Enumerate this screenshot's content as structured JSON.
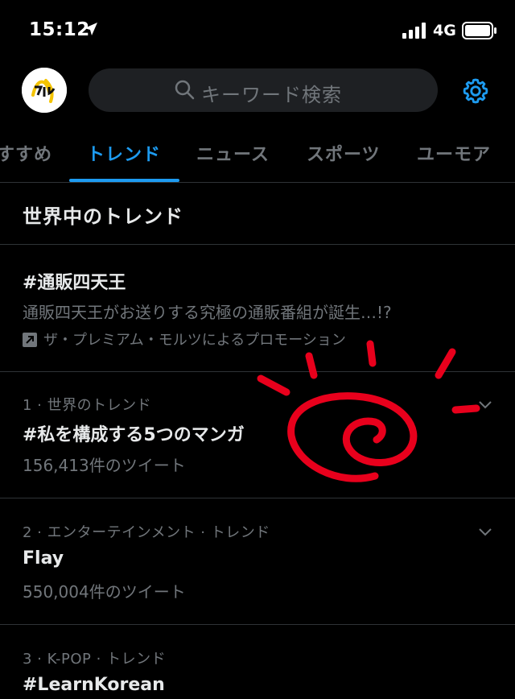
{
  "status_bar": {
    "time": "15:12",
    "network": "4G"
  },
  "header": {
    "search_placeholder": "キーワード検索"
  },
  "tabs": [
    {
      "label": "すすめ"
    },
    {
      "label": "トレンド",
      "active": true
    },
    {
      "label": "ニュース"
    },
    {
      "label": "スポーツ"
    },
    {
      "label": "ユーモア"
    }
  ],
  "section": {
    "title": "世界中のトレンド"
  },
  "promoted": {
    "title": "#通販四天王",
    "description": "通販四天王がお送りする究極の通販番組が誕生…!?",
    "promoted_by": "ザ・プレミアム・モルツによるプロモーション"
  },
  "trends": [
    {
      "meta": "1 · 世界のトレンド",
      "name": "#私を構成する5つのマンガ",
      "count": "156,413件のツイート"
    },
    {
      "meta": "2 · エンターテインメント · トレンド",
      "name": "Flay",
      "count": "550,004件のツイート"
    },
    {
      "meta": "3 · K-POP · トレンド",
      "name": "#LearnKorean"
    }
  ],
  "colors": {
    "accent": "#1d9bf0",
    "background": "#000000",
    "muted": "#71767b",
    "annotation": "#e8001c"
  }
}
